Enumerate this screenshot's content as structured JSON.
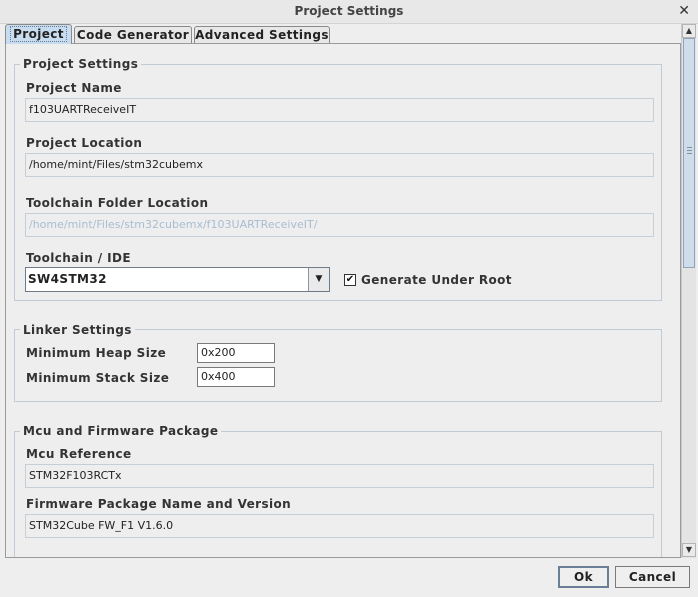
{
  "window": {
    "title": "Project Settings",
    "close_glyph": "✕"
  },
  "tabs": [
    {
      "label": "Project",
      "active": true
    },
    {
      "label": "Code Generator",
      "active": false
    },
    {
      "label": "Advanced Settings",
      "active": false
    }
  ],
  "project_settings": {
    "legend": "Project Settings",
    "project_name_label": "Project Name",
    "project_name_value": "f103UARTReceiveIT",
    "project_location_label": "Project Location",
    "project_location_value": "/home/mint/Files/stm32cubemx",
    "toolchain_folder_label": "Toolchain Folder Location",
    "toolchain_folder_value": "/home/mint/Files/stm32cubemx/f103UARTReceiveIT/",
    "toolchain_ide_label": "Toolchain / IDE",
    "toolchain_ide_value": "SW4STM32",
    "generate_under_root_label": "Generate Under Root",
    "generate_under_root_checked": true
  },
  "linker_settings": {
    "legend": "Linker Settings",
    "min_heap_label": "Minimum Heap Size",
    "min_heap_value": "0x200",
    "min_stack_label": "Minimum Stack Size",
    "min_stack_value": "0x400"
  },
  "mcu_firmware": {
    "legend": "Mcu and Firmware Package",
    "mcu_reference_label": "Mcu Reference",
    "mcu_reference_value": "STM32F103RCTx",
    "firmware_label": "Firmware Package Name and Version",
    "firmware_value": "STM32Cube FW_F1 V1.6.0"
  },
  "buttons": {
    "ok": "Ok",
    "cancel": "Cancel"
  },
  "icons": {
    "close": "close-icon",
    "dropdown": "chevron-down-icon",
    "check": "checkmark-icon"
  }
}
